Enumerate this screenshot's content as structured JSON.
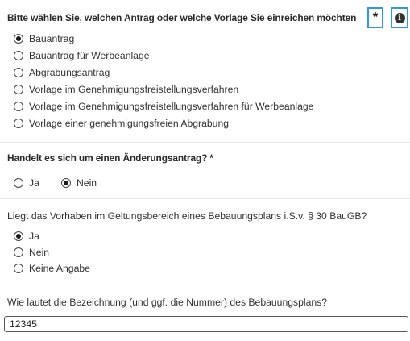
{
  "q1": {
    "label": "Bitte wählen Sie, welchen Antrag oder welche Vorlage Sie einreichen möchten",
    "required_marker": "*",
    "info_icon": "info-circle-icon",
    "options": [
      {
        "label": "Bauantrag",
        "checked": true
      },
      {
        "label": "Bauantrag für Werbeanlage",
        "checked": false
      },
      {
        "label": "Abgrabungsantrag",
        "checked": false
      },
      {
        "label": "Vorlage im Genehmigungsfreistellungsverfahren",
        "checked": false
      },
      {
        "label": "Vorlage im Genehmigungsfreistellungsverfahren für Werbeanlage",
        "checked": false
      },
      {
        "label": "Vorlage einer genehmigungsfreien Abgrabung",
        "checked": false
      }
    ]
  },
  "q2": {
    "label": "Handelt es sich um einen Änderungsantrag?",
    "required_marker": "*",
    "options": [
      {
        "label": "Ja",
        "checked": false
      },
      {
        "label": "Nein",
        "checked": true
      }
    ]
  },
  "q3": {
    "label": "Liegt das Vorhaben im Geltungsbereich eines Bebauungsplans i.S.v. § 30 BauGB?",
    "options": [
      {
        "label": "Ja",
        "checked": true
      },
      {
        "label": "Nein",
        "checked": false
      },
      {
        "label": "Keine Angabe",
        "checked": false
      }
    ]
  },
  "q4": {
    "label": "Wie lautet die Bezeichnung (und ggf. die Nummer) des Bebauungsplans?",
    "value": "12345"
  },
  "colors": {
    "highlight_border": "#2f96f1",
    "divider": "#e6e6e6",
    "text": "#333333"
  }
}
